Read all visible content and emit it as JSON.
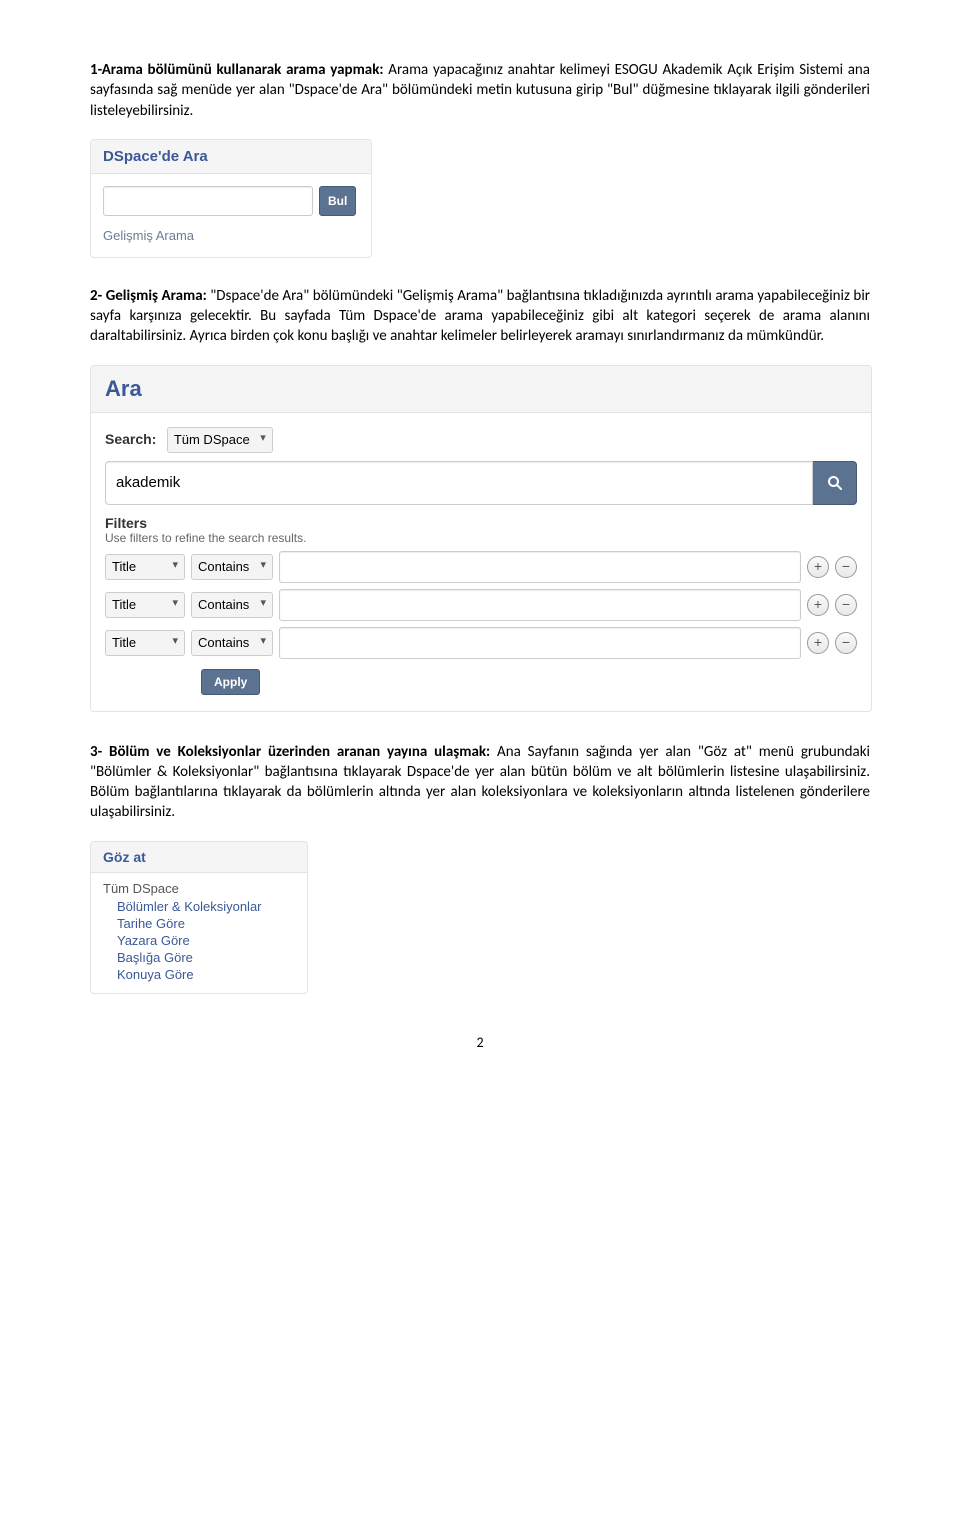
{
  "para1": {
    "lead_bold": "1-Arama bölümünü kullanarak arama yapmak:",
    "rest": " Arama yapacağınız anahtar kelimeyi ESOGU Akademik Açık Erişim Sistemi ana sayfasında sağ menüde yer alan \"Dspace'de Ara\" bölümündeki metin kutusuna girip \"Bul\" düğmesine tıklayarak ilgili gönderileri listeleyebilirsiniz."
  },
  "search_box": {
    "title": "DSpace'de Ara",
    "button": "Bul",
    "adv": "Gelişmiş Arama"
  },
  "para2": {
    "lead_bold": "2- Gelişmiş Arama:",
    "rest": " \"Dspace'de Ara\" bölümündeki \"Gelişmiş Arama\" bağlantısına tıkladığınızda ayrıntılı arama yapabileceğiniz bir sayfa karşınıza gelecektir. Bu sayfada Tüm Dspace'de arama yapabileceğiniz gibi alt kategori seçerek de arama alanını daraltabilirsiniz. Ayrıca birden çok konu başlığı ve anahtar kelimeler belirleyerek aramayı sınırlandırmanız da mümkündür."
  },
  "ara_panel": {
    "heading": "Ara",
    "search_label": "Search:",
    "scope_value": "Tüm DSpace",
    "query_value": "akademik",
    "filters_title": "Filters",
    "filters_sub": "Use filters to refine the search results.",
    "filter_field": "Title",
    "filter_op": "Contains",
    "apply": "Apply"
  },
  "para3": {
    "lead_bold": "3- Bölüm ve Koleksiyonlar üzerinden aranan yayına ulaşmak:",
    "rest": " Ana Sayfanın sağında yer alan \"Göz at\" menü grubundaki \"Bölümler & Koleksiyonlar\" bağlantısına tıklayarak Dspace'de yer alan bütün bölüm ve alt bölümlerin listesine ulaşabilirsiniz. Bölüm bağlantılarına tıklayarak da bölümlerin altında yer alan koleksiyonlara ve koleksiyonların altında listelenen gönderilere ulaşabilirsiniz."
  },
  "browse_panel": {
    "heading": "Göz at",
    "group": "Tüm DSpace",
    "links": {
      "0": "Bölümler & Koleksiyonlar",
      "1": "Tarihe Göre",
      "2": "Yazara Göre",
      "3": "Başlığa Göre",
      "4": "Konuya Göre"
    }
  },
  "page_number": "2"
}
